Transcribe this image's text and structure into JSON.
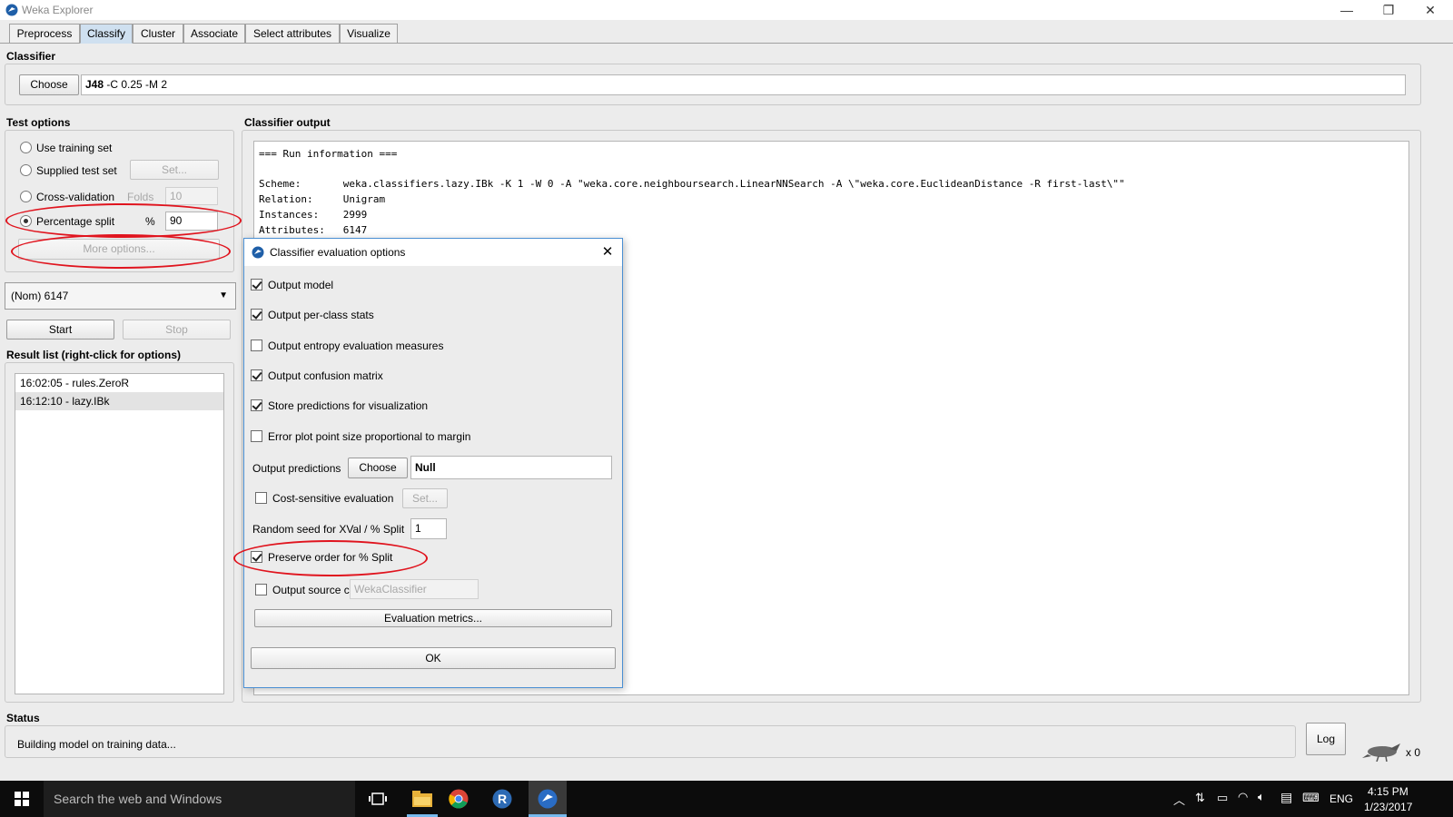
{
  "window": {
    "title": "Weka Explorer",
    "minimize": "—",
    "restore": "❐",
    "close": "✕"
  },
  "tabs": [
    {
      "label": "Preprocess"
    },
    {
      "label": "Classify",
      "active": true
    },
    {
      "label": "Cluster"
    },
    {
      "label": "Associate"
    },
    {
      "label": "Select attributes"
    },
    {
      "label": "Visualize"
    }
  ],
  "classifier": {
    "section_title": "Classifier",
    "choose_label": "Choose",
    "name": "J48",
    "args": "-C 0.25 -M 2"
  },
  "test_options": {
    "section_title": "Test options",
    "use_training_set": "Use training set",
    "supplied_test_set": "Supplied test set",
    "set_label": "Set...",
    "cross_validation": "Cross-validation",
    "folds_label": "Folds",
    "folds_value": "10",
    "percentage_split": "Percentage split",
    "percent_sign": "%",
    "percentage_value": "90",
    "more_options": "More options..."
  },
  "class_select": {
    "value": "(Nom) 6147"
  },
  "controls": {
    "start": "Start",
    "stop": "Stop"
  },
  "result_list": {
    "title": "Result list (right-click for options)",
    "items": [
      "16:02:05 - rules.ZeroR",
      "16:12:10 - lazy.IBk"
    ]
  },
  "output": {
    "section_title": "Classifier output",
    "lines": [
      "=== Run information ===",
      "",
      "Scheme:       weka.classifiers.lazy.IBk -K 1 -W 0 -A \"weka.core.neighboursearch.LinearNNSearch -A \\\"weka.core.EuclideanDistance -R first-last\\\"\"",
      "Relation:     Unigram",
      "Instances:    2999",
      "Attributes:   6147"
    ]
  },
  "dialog": {
    "title": "Classifier evaluation options",
    "close": "✕",
    "options": [
      {
        "label": "Output model",
        "checked": true
      },
      {
        "label": "Output per-class stats",
        "checked": true
      },
      {
        "label": "Output entropy evaluation measures",
        "checked": false
      },
      {
        "label": "Output confusion matrix",
        "checked": true
      },
      {
        "label": "Store predictions for visualization",
        "checked": true
      },
      {
        "label": "Error plot point size proportional to margin",
        "checked": false
      }
    ],
    "output_predictions_label": "Output predictions",
    "choose_label": "Choose",
    "output_predictions_value": "Null",
    "cost_sensitive_label": "Cost-sensitive evaluation",
    "cost_sensitive_checked": false,
    "set_label": "Set...",
    "random_seed_label": "Random seed for XVal / % Split",
    "random_seed_value": "1",
    "preserve_order_label": "Preserve order for % Split",
    "preserve_order_checked": true,
    "output_source_label": "Output source code",
    "output_source_checked": false,
    "output_source_value": "WekaClassifier",
    "evaluation_metrics": "Evaluation metrics...",
    "ok": "OK"
  },
  "status": {
    "section_title": "Status",
    "text": "Building model on training data...",
    "log_label": "Log",
    "count": "x 0"
  },
  "taskbar": {
    "search_placeholder": "Search the web and Windows",
    "lang": "ENG",
    "time": "4:15 PM",
    "date": "1/23/2017"
  }
}
